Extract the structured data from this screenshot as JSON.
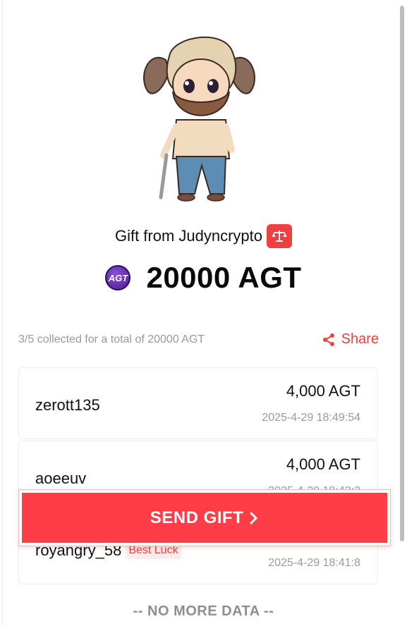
{
  "gift": {
    "from_text": "Gift from Judyncrypto",
    "amount": "20000 AGT",
    "token_icon_label": "AGT",
    "verify_icon": "scale-icon"
  },
  "summary": {
    "collected_text": "3/5 collected for a total of 20000 AGT",
    "share_label": "Share",
    "share_icon": "share-icon"
  },
  "claims": [
    {
      "name": "zerott135",
      "amount": "4,000 AGT",
      "time": "2025-4-29 18:49:54",
      "badge": ""
    },
    {
      "name": "aoeeuv",
      "amount": "4,000 AGT",
      "time": "2025-4-29 18:43:3",
      "badge": ""
    },
    {
      "name": "royangry_58",
      "amount": "",
      "time": "2025-4-29 18:41:8",
      "badge": "Best Luck"
    }
  ],
  "actions": {
    "send_gift_label": "SEND GIFT"
  },
  "footer": {
    "no_more": "-- NO MORE DATA --"
  },
  "colors": {
    "accent": "#ff3d47",
    "muted": "#999999",
    "badge_bg": "#fdecec"
  }
}
